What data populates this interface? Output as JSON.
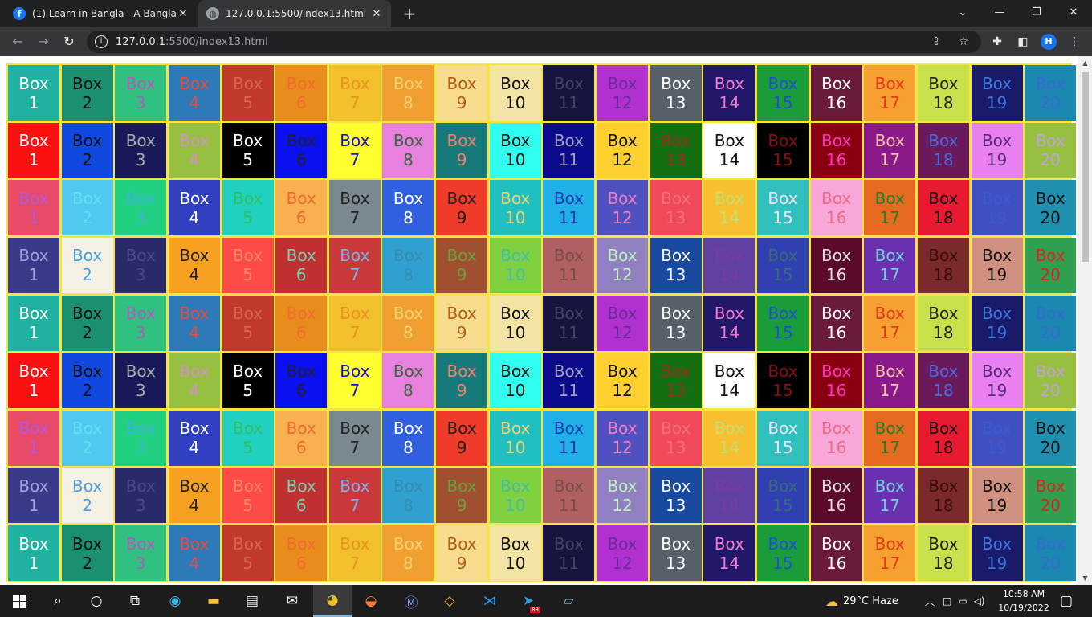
{
  "browser": {
    "tabs": [
      {
        "title": "(1) Learn in Bangla - A Banglades",
        "favicon": "facebook-icon"
      },
      {
        "title": "127.0.0.1:5500/index13.html",
        "favicon": "globe-icon"
      }
    ],
    "address": {
      "host": "127.0.0.1",
      "rest": ":5500/index13.html"
    },
    "profile_initial": "H"
  },
  "box_label": "Box",
  "pattern_rows": [
    [
      {
        "bg": "#20b2a0",
        "fg": "#ffffff"
      },
      {
        "bg": "#1a9070",
        "fg": "#111111"
      },
      {
        "bg": "#30c080",
        "fg": "#b05ac0"
      },
      {
        "bg": "#2e7ab8",
        "fg": "#e74c3c"
      },
      {
        "bg": "#c0392b",
        "fg": "#d6664f"
      },
      {
        "bg": "#e88c1c",
        "fg": "#f26a30"
      },
      {
        "bg": "#f2c02c",
        "fg": "#e89222"
      },
      {
        "bg": "#f0a030",
        "fg": "#f7d070"
      },
      {
        "bg": "#f7dc8e",
        "fg": "#b85a1a"
      },
      {
        "bg": "#f4e4a4",
        "fg": "#111111"
      },
      {
        "bg": "#14143c",
        "fg": "#444466"
      },
      {
        "bg": "#b030d0",
        "fg": "#6a2a9a"
      },
      {
        "bg": "#56606a",
        "fg": "#ffffff"
      },
      {
        "bg": "#22186a",
        "fg": "#f07ad0"
      },
      {
        "bg": "#1a9c3a",
        "fg": "#2050d0"
      },
      {
        "bg": "#6a1a3a",
        "fg": "#ffffff"
      },
      {
        "bg": "#f5a030",
        "fg": "#e83a1a"
      },
      {
        "bg": "#c8e04a",
        "fg": "#222222"
      },
      {
        "bg": "#1a1a6a",
        "fg": "#3a7ae0"
      },
      {
        "bg": "#1a88b0",
        "fg": "#3a6ad0"
      }
    ],
    [
      {
        "bg": "#ff1010",
        "fg": "#ffffff"
      },
      {
        "bg": "#1048e0",
        "fg": "#111111"
      },
      {
        "bg": "#1a1a5a",
        "fg": "#aaaaaa"
      },
      {
        "bg": "#98c040",
        "fg": "#d090d0"
      },
      {
        "bg": "#000000",
        "fg": "#ffffff"
      },
      {
        "bg": "#0a10f0",
        "fg": "#222222"
      },
      {
        "bg": "#ffff30",
        "fg": "#1010d0"
      },
      {
        "bg": "#e880e0",
        "fg": "#3a6a3a"
      },
      {
        "bg": "#167a7a",
        "fg": "#ff7a6a"
      },
      {
        "bg": "#30fff0",
        "fg": "#111111"
      },
      {
        "bg": "#0a0a8a",
        "fg": "#a0a0c0"
      },
      {
        "bg": "#ffd030",
        "fg": "#111111"
      },
      {
        "bg": "#127012",
        "fg": "#a02a20"
      },
      {
        "bg": "#ffffff",
        "fg": "#111111"
      },
      {
        "bg": "#000000",
        "fg": "#8a1010"
      },
      {
        "bg": "#8a0010",
        "fg": "#ff30c0"
      },
      {
        "bg": "#8a1a8a",
        "fg": "#f0c0a0"
      },
      {
        "bg": "#6a1a5a",
        "fg": "#4a6ae0"
      },
      {
        "bg": "#e880f0",
        "fg": "#5a2a7a"
      },
      {
        "bg": "#98c040",
        "fg": "#c0a0e0"
      }
    ],
    [
      {
        "bg": "#e84a6a",
        "fg": "#b05ae0"
      },
      {
        "bg": "#50c8f0",
        "fg": "#60e0f0"
      },
      {
        "bg": "#20d080",
        "fg": "#40b0e0"
      },
      {
        "bg": "#3040c0",
        "fg": "#ffffff"
      },
      {
        "bg": "#20d0c0",
        "fg": "#30c060"
      },
      {
        "bg": "#f8b050",
        "fg": "#f06a30"
      },
      {
        "bg": "#7a8890",
        "fg": "#222222"
      },
      {
        "bg": "#3060e0",
        "fg": "#ffffff"
      },
      {
        "bg": "#f03a2a",
        "fg": "#222222"
      },
      {
        "bg": "#20c0c0",
        "fg": "#f0d070"
      },
      {
        "bg": "#20b0e8",
        "fg": "#1a3ab0"
      },
      {
        "bg": "#5050c0",
        "fg": "#f080c0"
      },
      {
        "bg": "#f04a5a",
        "fg": "#f0707a"
      },
      {
        "bg": "#f8c030",
        "fg": "#c0e070"
      },
      {
        "bg": "#30c0c0",
        "fg": "#f0e0f0"
      },
      {
        "bg": "#f8a8d8",
        "fg": "#f06a8a"
      },
      {
        "bg": "#e86a20",
        "fg": "#20802a"
      },
      {
        "bg": "#e81a30",
        "fg": "#111111"
      },
      {
        "bg": "#4050c0",
        "fg": "#3a5ad0"
      },
      {
        "bg": "#2090b0",
        "fg": "#111111"
      }
    ],
    [
      {
        "bg": "#3a3a8a",
        "fg": "#a0a0e0"
      },
      {
        "bg": "#f4f0e4",
        "fg": "#4aa0e0"
      },
      {
        "bg": "#2a2a6a",
        "fg": "#4a4a8a"
      },
      {
        "bg": "#f8a020",
        "fg": "#222222"
      },
      {
        "bg": "#ff4a4a",
        "fg": "#ff8a5a"
      },
      {
        "bg": "#c03030",
        "fg": "#7ad0b0"
      },
      {
        "bg": "#c83a3a",
        "fg": "#7ab0f0"
      },
      {
        "bg": "#30a0d0",
        "fg": "#3a8ab0"
      },
      {
        "bg": "#a05030",
        "fg": "#6aa040"
      },
      {
        "bg": "#80d040",
        "fg": "#40c0a0"
      },
      {
        "bg": "#b06060",
        "fg": "#7a4a4a"
      },
      {
        "bg": "#9080c0",
        "fg": "#c0f0c0"
      },
      {
        "bg": "#1a4aa0",
        "fg": "#ffffff"
      },
      {
        "bg": "#6040a0",
        "fg": "#7a3aa0"
      },
      {
        "bg": "#3040b0",
        "fg": "#3a6a7a"
      },
      {
        "bg": "#5a0a2a",
        "fg": "#dddddd"
      },
      {
        "bg": "#6a30b0",
        "fg": "#70d0e0"
      },
      {
        "bg": "#7a2a2a",
        "fg": "#3a0a0a"
      },
      {
        "bg": "#d09080",
        "fg": "#111111"
      },
      {
        "bg": "#30a050",
        "fg": "#e02020"
      }
    ]
  ],
  "row_pattern": [
    0,
    1,
    2,
    3,
    0,
    1,
    2,
    3,
    0
  ],
  "taskbar": {
    "weather": "29°C  Haze",
    "time": "10:58 AM",
    "date": "10/19/2022",
    "telegram_badge": "88"
  }
}
